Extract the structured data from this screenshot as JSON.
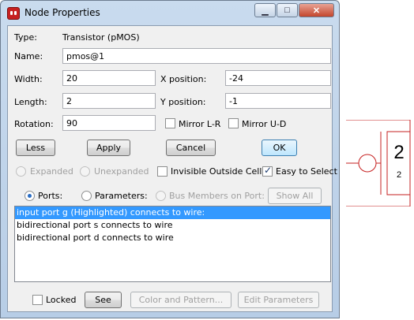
{
  "window": {
    "title": "Node Properties",
    "controls": {
      "minimize": "▁",
      "maximize": "□",
      "close": "✕"
    }
  },
  "type": {
    "label": "Type:",
    "value": "Transistor (pMOS)"
  },
  "name": {
    "label": "Name:",
    "value": "pmos@1"
  },
  "width": {
    "label": "Width:",
    "value": "20"
  },
  "x_position": {
    "label": "X position:",
    "value": "-24"
  },
  "length": {
    "label": "Length:",
    "value": "2"
  },
  "y_position": {
    "label": "Y position:",
    "value": "-1"
  },
  "rotation": {
    "label": "Rotation:",
    "value": "90"
  },
  "mirror_lr": {
    "label": "Mirror L-R",
    "checked": false
  },
  "mirror_ud": {
    "label": "Mirror U-D",
    "checked": false
  },
  "buttons": {
    "less": "Less",
    "apply": "Apply",
    "cancel": "Cancel",
    "ok": "OK"
  },
  "expansion": {
    "expanded": "Expanded",
    "unexpanded": "Unexpanded"
  },
  "invisible_outside_cell": {
    "label": "Invisible Outside Cell",
    "checked": false
  },
  "easy_to_select": {
    "label": "Easy to Select",
    "checked": true
  },
  "view_mode": {
    "ports": "Ports:",
    "parameters": "Parameters:",
    "bus_members": "Bus Members on Port:",
    "selected": "ports",
    "show_all": "Show All"
  },
  "ports_list": [
    {
      "text": "input port g (Highlighted) connects to wire:",
      "selected": true
    },
    {
      "text": "bidirectional port s connects to wire",
      "selected": false
    },
    {
      "text": "bidirectional port d connects to wire",
      "selected": false
    }
  ],
  "footer": {
    "locked": {
      "label": "Locked",
      "checked": false
    },
    "see": "See",
    "color_and_pattern": "Color and Pattern...",
    "edit_parameters": "Edit Parameters"
  },
  "schematic": {
    "big_label": "2",
    "small_label": "2",
    "stroke_color": "#c62020"
  },
  "colors": {
    "selection": "#3399ff",
    "title_bar": "#c9dbee",
    "dialog_bg": "#f0f0f0"
  }
}
